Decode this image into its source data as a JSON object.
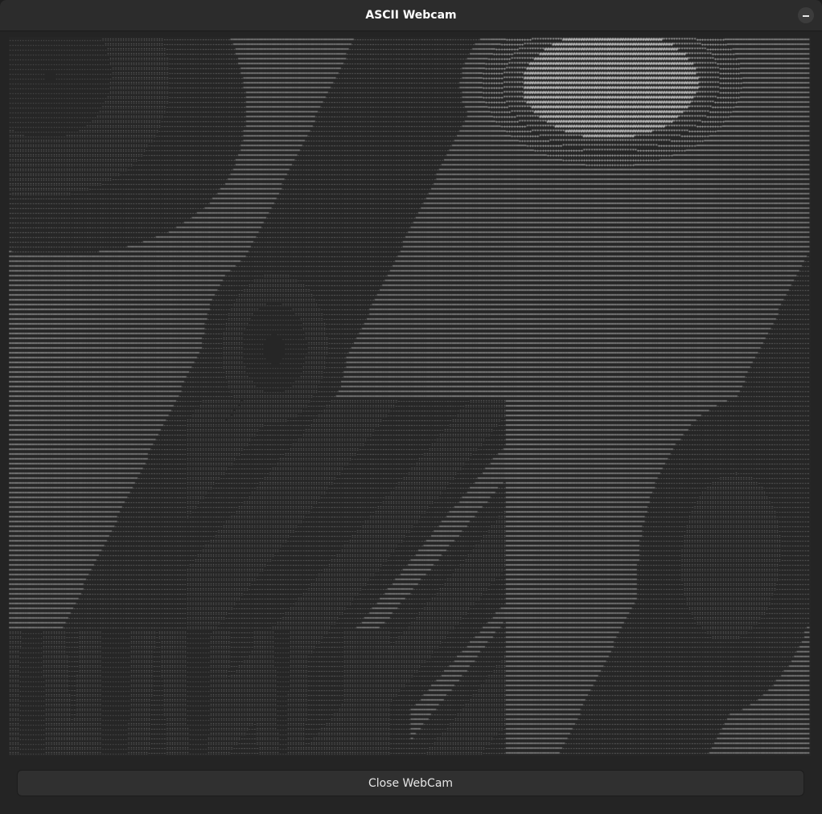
{
  "window": {
    "title": "ASCII Webcam",
    "minimize_icon": "minimize-icon"
  },
  "ascii_view": {
    "charset": " .:-=+*#",
    "text_color": "#dcdcdc",
    "background_color": "#262626"
  },
  "footer": {
    "close_label": "Close WebCam"
  }
}
